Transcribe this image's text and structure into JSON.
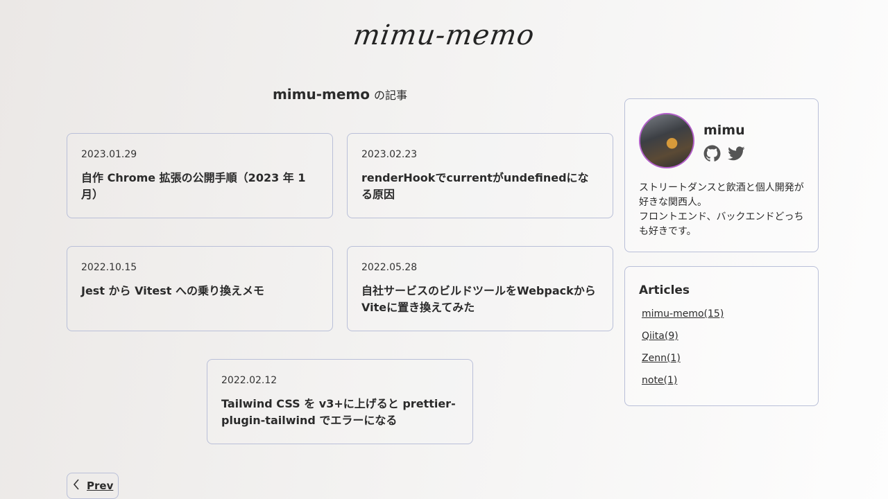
{
  "site": {
    "logo": "mimu-memo"
  },
  "section": {
    "title": "mimu-memo",
    "suffix": "の記事"
  },
  "posts": [
    {
      "date": "2023.01.29",
      "title": "自作 Chrome 拡張の公開手順（2023 年 1 月）"
    },
    {
      "date": "2023.02.23",
      "title": "renderHookでcurrentがundefinedになる原因"
    },
    {
      "date": "2022.10.15",
      "title": "Jest から Vitest への乗り換えメモ"
    },
    {
      "date": "2022.05.28",
      "title": "自社サービスのビルドツールをWebpackからViteに置き換えてみた"
    },
    {
      "date": "2022.02.12",
      "title": "Tailwind CSS を v3+に上げると prettier-plugin-tailwind でエラーになる"
    }
  ],
  "pagination": {
    "prev_label": "Prev"
  },
  "profile": {
    "name": "mimu",
    "bio_line1": "ストリートダンスと飲酒と個人開発が好きな関西人。",
    "bio_line2": "フロントエンド、バックエンドどっちも好きです。",
    "social": [
      "github-icon",
      "twitter-icon"
    ]
  },
  "articles": {
    "title": "Articles",
    "links": [
      "mimu-memo(15)",
      "Qiita(9)",
      "Zenn(1)",
      "note(1)"
    ]
  },
  "colors": {
    "border": "#b9bfd8",
    "avatar_ring": "#b25fc9",
    "icon": "#555555"
  }
}
